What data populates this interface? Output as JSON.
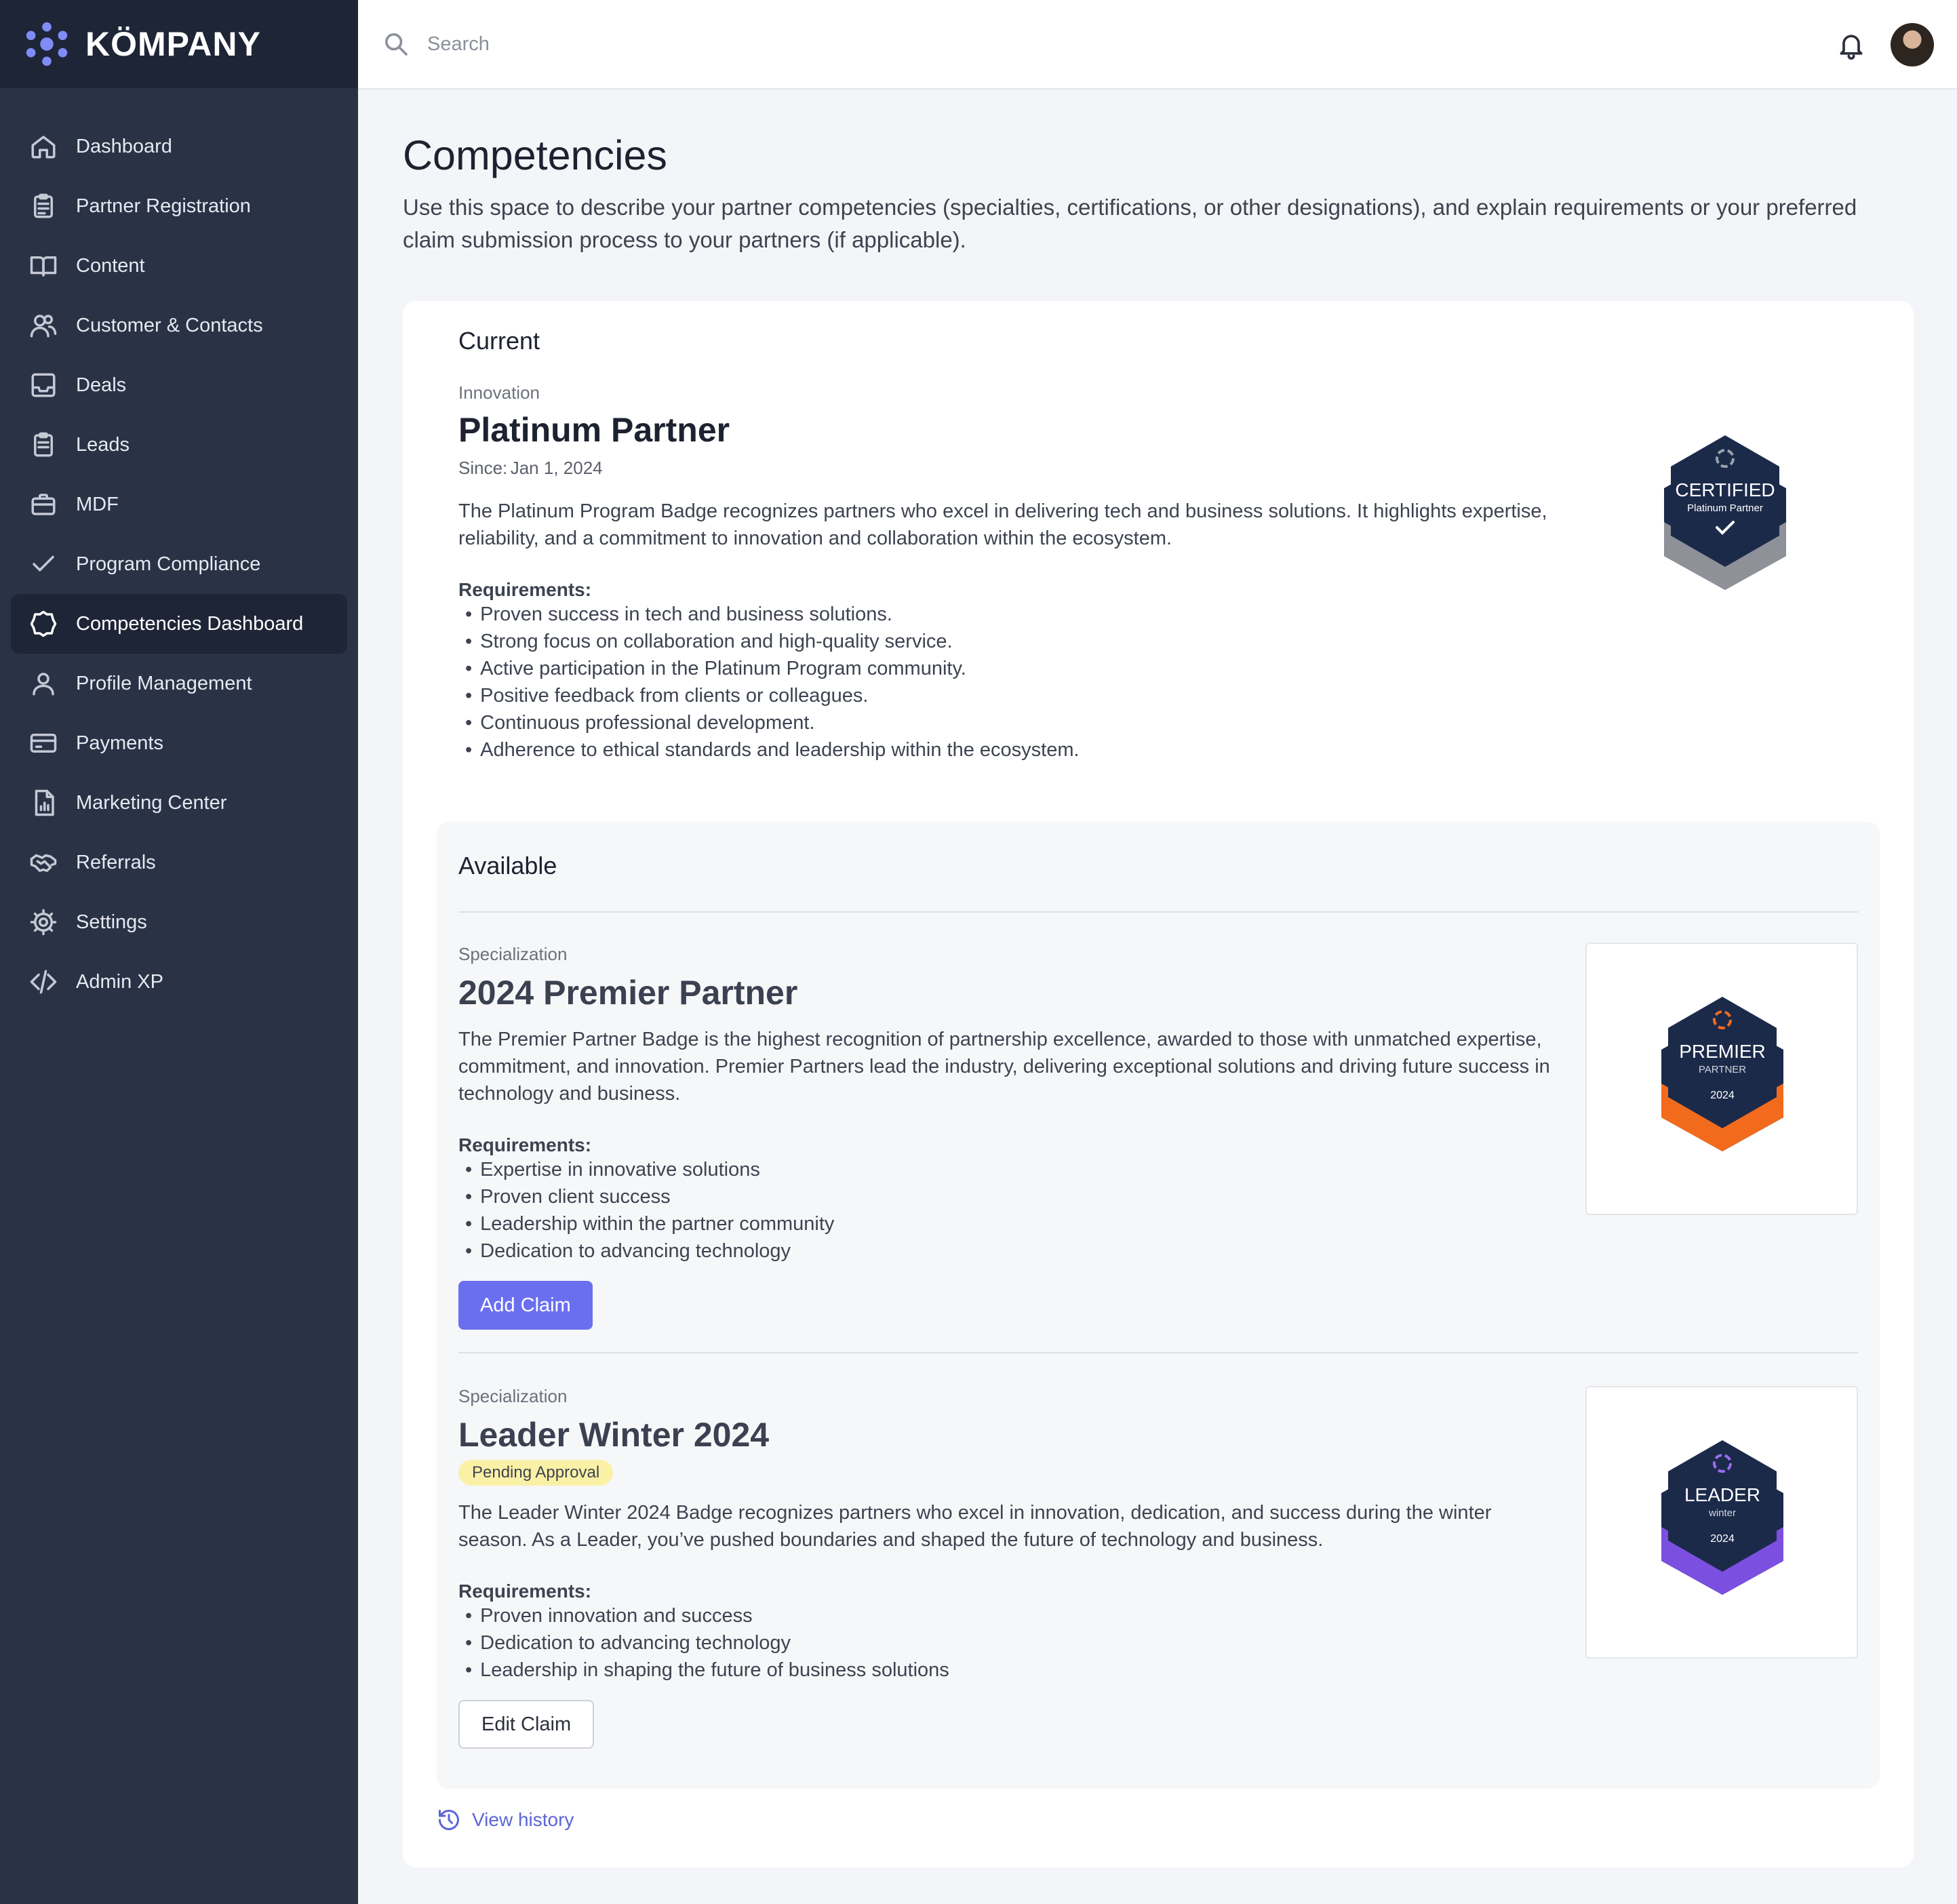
{
  "brand": {
    "name": "KÖMPANY"
  },
  "colors": {
    "sidebar": "#2a3246",
    "accent": "#6a6ff0",
    "pending": "#fbf1a6"
  },
  "sidebar": {
    "items": [
      {
        "label": "Dashboard",
        "icon": "home-icon"
      },
      {
        "label": "Partner Registration",
        "icon": "clipboard-icon"
      },
      {
        "label": "Content",
        "icon": "book-icon"
      },
      {
        "label": "Customer & Contacts",
        "icon": "users-icon"
      },
      {
        "label": "Deals",
        "icon": "inbox-icon"
      },
      {
        "label": "Leads",
        "icon": "clipboard-list-icon"
      },
      {
        "label": "MDF",
        "icon": "briefcase-icon"
      },
      {
        "label": "Program Compliance",
        "icon": "check-icon"
      },
      {
        "label": "Competencies Dashboard",
        "icon": "badge-icon",
        "active": true
      },
      {
        "label": "Profile Management",
        "icon": "user-icon"
      },
      {
        "label": "Payments",
        "icon": "credit-card-icon"
      },
      {
        "label": "Marketing Center",
        "icon": "chart-document-icon"
      },
      {
        "label": "Referrals",
        "icon": "handshake-icon"
      },
      {
        "label": "Settings",
        "icon": "gear-icon"
      },
      {
        "label": "Admin XP",
        "icon": "code-icon"
      }
    ]
  },
  "search": {
    "placeholder": "Search"
  },
  "page": {
    "title": "Competencies",
    "description": "Use this space to describe your partner competencies (specialties, certifications, or other designations), and explain requirements or your preferred claim submission process to your partners (if applicable)."
  },
  "current": {
    "section_title": "Current",
    "category": "Innovation",
    "title": "Platinum Partner",
    "since_label": "Since:",
    "since_value": "Jan 1, 2024",
    "description": "The Platinum Program Badge recognizes partners who excel in delivering tech and business solutions. It highlights expertise, reliability, and a commitment to innovation and collaboration within the ecosystem.",
    "requirements_label": "Requirements:",
    "requirements": [
      "Proven success in tech and business solutions.",
      "Strong focus on collaboration and high-quality service.",
      "Active participation in the Platinum Program community.",
      "Positive feedback from clients or colleagues.",
      "Continuous professional development.",
      "Adherence to ethical standards and leadership within the ecosystem."
    ],
    "badge": {
      "line1": "CERTIFIED",
      "line2": "Platinum Partner"
    }
  },
  "available": {
    "section_title": "Available",
    "items": [
      {
        "category": "Specialization",
        "title": "2024 Premier Partner",
        "description": "The Premier Partner Badge is the highest recognition of partnership excellence, awarded to those with unmatched expertise, commitment, and innovation. Premier Partners lead the industry, delivering exceptional solutions and driving future success in technology and business.",
        "requirements_label": "Requirements:",
        "requirements": [
          "Expertise in innovative solutions",
          "Proven client success",
          "Leadership within the partner community",
          "Dedication to advancing technology"
        ],
        "button": "Add Claim",
        "badge": {
          "line1": "PREMIER",
          "line2": "PARTNER",
          "year": "2024"
        }
      },
      {
        "category": "Specialization",
        "title": "Leader Winter 2024",
        "status": "Pending Approval",
        "description": "The Leader Winter 2024 Badge recognizes partners who excel in innovation, dedication, and success during the winter season. As a Leader, you’ve pushed boundaries and shaped the future of technology and business.",
        "requirements_label": "Requirements:",
        "requirements": [
          "Proven innovation and success",
          "Dedication to advancing technology",
          "Leadership in shaping the future of business solutions"
        ],
        "button": "Edit Claim",
        "badge": {
          "line1": "LEADER",
          "line2": "winter",
          "year": "2024"
        }
      }
    ]
  },
  "history_link": "View history"
}
